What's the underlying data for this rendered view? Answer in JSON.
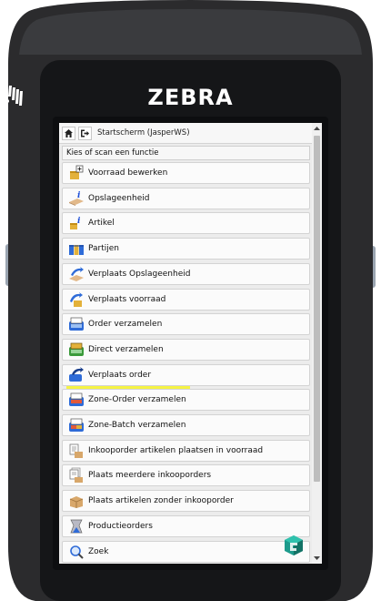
{
  "device": {
    "brand": "ZEBRA",
    "colors": {
      "body": "#2b2b2d",
      "bezel": "#111214",
      "side_buttons": "#9aa4b0",
      "brand_text": "#ffffff"
    }
  },
  "topbar": {
    "home_icon": "home-icon",
    "logout_icon": "logout-icon",
    "title": "Startscherm (JasperWS)"
  },
  "prompt": "Kies of scan een functie",
  "highlight_color": "#f6f33a",
  "menu_items": [
    {
      "label": "Voorraad bewerken",
      "icon": "stock-edit-icon"
    },
    {
      "label": "Opslageenheid",
      "icon": "storage-unit-info-icon"
    },
    {
      "label": "Artikel",
      "icon": "article-info-icon"
    },
    {
      "label": "Partijen",
      "icon": "batches-icon"
    },
    {
      "label": "Verplaats Opslageenheid",
      "icon": "move-storage-unit-icon"
    },
    {
      "label": "Verplaats voorraad",
      "icon": "move-stock-icon"
    },
    {
      "label": "Order verzamelen",
      "icon": "order-pick-icon"
    },
    {
      "label": "Direct verzamelen",
      "icon": "direct-pick-icon"
    },
    {
      "label": "Verplaats order",
      "icon": "move-order-icon"
    },
    {
      "label": "Zone-Order verzamelen",
      "icon": "zone-order-pick-icon"
    },
    {
      "label": "Zone-Batch verzamelen",
      "icon": "zone-batch-pick-icon"
    },
    {
      "label": "Inkooporder artikelen plaatsen in voorraad",
      "icon": "purchase-order-putaway-icon"
    },
    {
      "label": "Plaats meerdere inkooporders",
      "icon": "multiple-purchase-orders-icon"
    },
    {
      "label": "Plaats artikelen zonder inkooporder",
      "icon": "putaway-without-po-icon"
    },
    {
      "label": "Productieorders",
      "icon": "production-orders-icon"
    },
    {
      "label": "Zoek",
      "icon": "search-icon"
    }
  ]
}
